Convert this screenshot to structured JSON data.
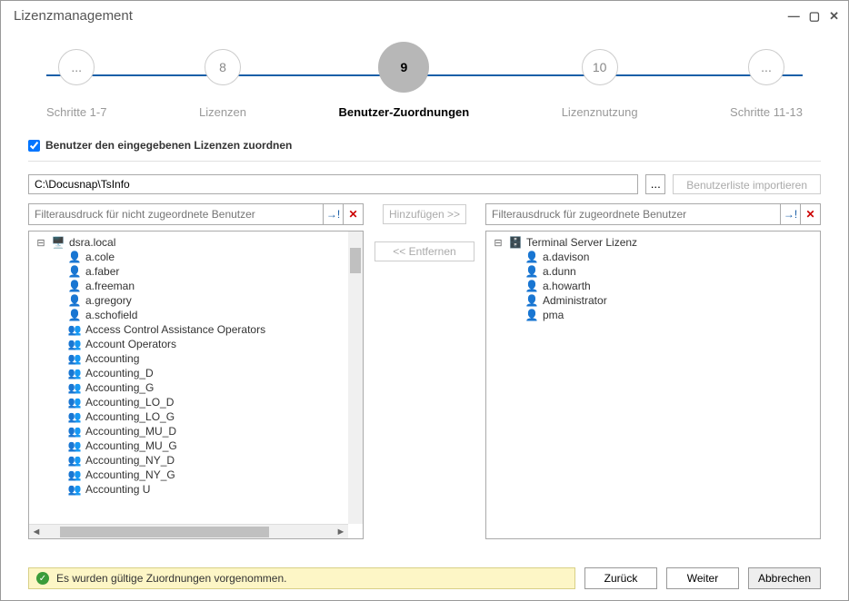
{
  "window": {
    "title": "Lizenzmanagement"
  },
  "wizard": {
    "steps": [
      {
        "num": "...",
        "label": "Schritte 1-7"
      },
      {
        "num": "8",
        "label": "Lizenzen"
      },
      {
        "num": "9",
        "label": "Benutzer-Zuordnungen",
        "active": true
      },
      {
        "num": "10",
        "label": "Lizenznutzung"
      },
      {
        "num": "...",
        "label": "Schritte 11-13"
      }
    ]
  },
  "checkbox": {
    "label": "Benutzer den eingegebenen Lizenzen zuordnen",
    "checked": true
  },
  "path": {
    "value": "C:\\Docusnap\\TsInfo",
    "browse": "..."
  },
  "buttons": {
    "import": "Benutzerliste importieren",
    "add": "Hinzufügen >>",
    "remove": "<< Entfernen",
    "back": "Zurück",
    "next": "Weiter",
    "cancel": "Abbrechen"
  },
  "left": {
    "filter_placeholder": "Filterausdruck für nicht zugeordnete Benutzer",
    "root": "dsra.local",
    "items": [
      {
        "type": "user",
        "name": "a.cole"
      },
      {
        "type": "user",
        "name": "a.faber"
      },
      {
        "type": "user",
        "name": "a.freeman"
      },
      {
        "type": "user",
        "name": "a.gregory"
      },
      {
        "type": "user",
        "name": "a.schofield"
      },
      {
        "type": "group",
        "name": "Access Control Assistance Operators"
      },
      {
        "type": "group",
        "name": "Account Operators"
      },
      {
        "type": "group",
        "name": "Accounting"
      },
      {
        "type": "group",
        "name": "Accounting_D"
      },
      {
        "type": "group",
        "name": "Accounting_G"
      },
      {
        "type": "group",
        "name": "Accounting_LO_D"
      },
      {
        "type": "group",
        "name": "Accounting_LO_G"
      },
      {
        "type": "group",
        "name": "Accounting_MU_D"
      },
      {
        "type": "group",
        "name": "Accounting_MU_G"
      },
      {
        "type": "group",
        "name": "Accounting_NY_D"
      },
      {
        "type": "group",
        "name": "Accounting_NY_G"
      },
      {
        "type": "group",
        "name": "Accounting U"
      }
    ]
  },
  "right": {
    "filter_placeholder": "Filterausdruck für zugeordnete Benutzer",
    "root": "Terminal Server Lizenz",
    "items": [
      {
        "type": "user",
        "name": "a.davison"
      },
      {
        "type": "user",
        "name": "a.dunn"
      },
      {
        "type": "user",
        "name": "a.howarth"
      },
      {
        "type": "user",
        "name": "Administrator"
      },
      {
        "type": "user",
        "name": "pma"
      }
    ]
  },
  "status": {
    "message": "Es wurden gültige Zuordnungen vorgenommen."
  }
}
